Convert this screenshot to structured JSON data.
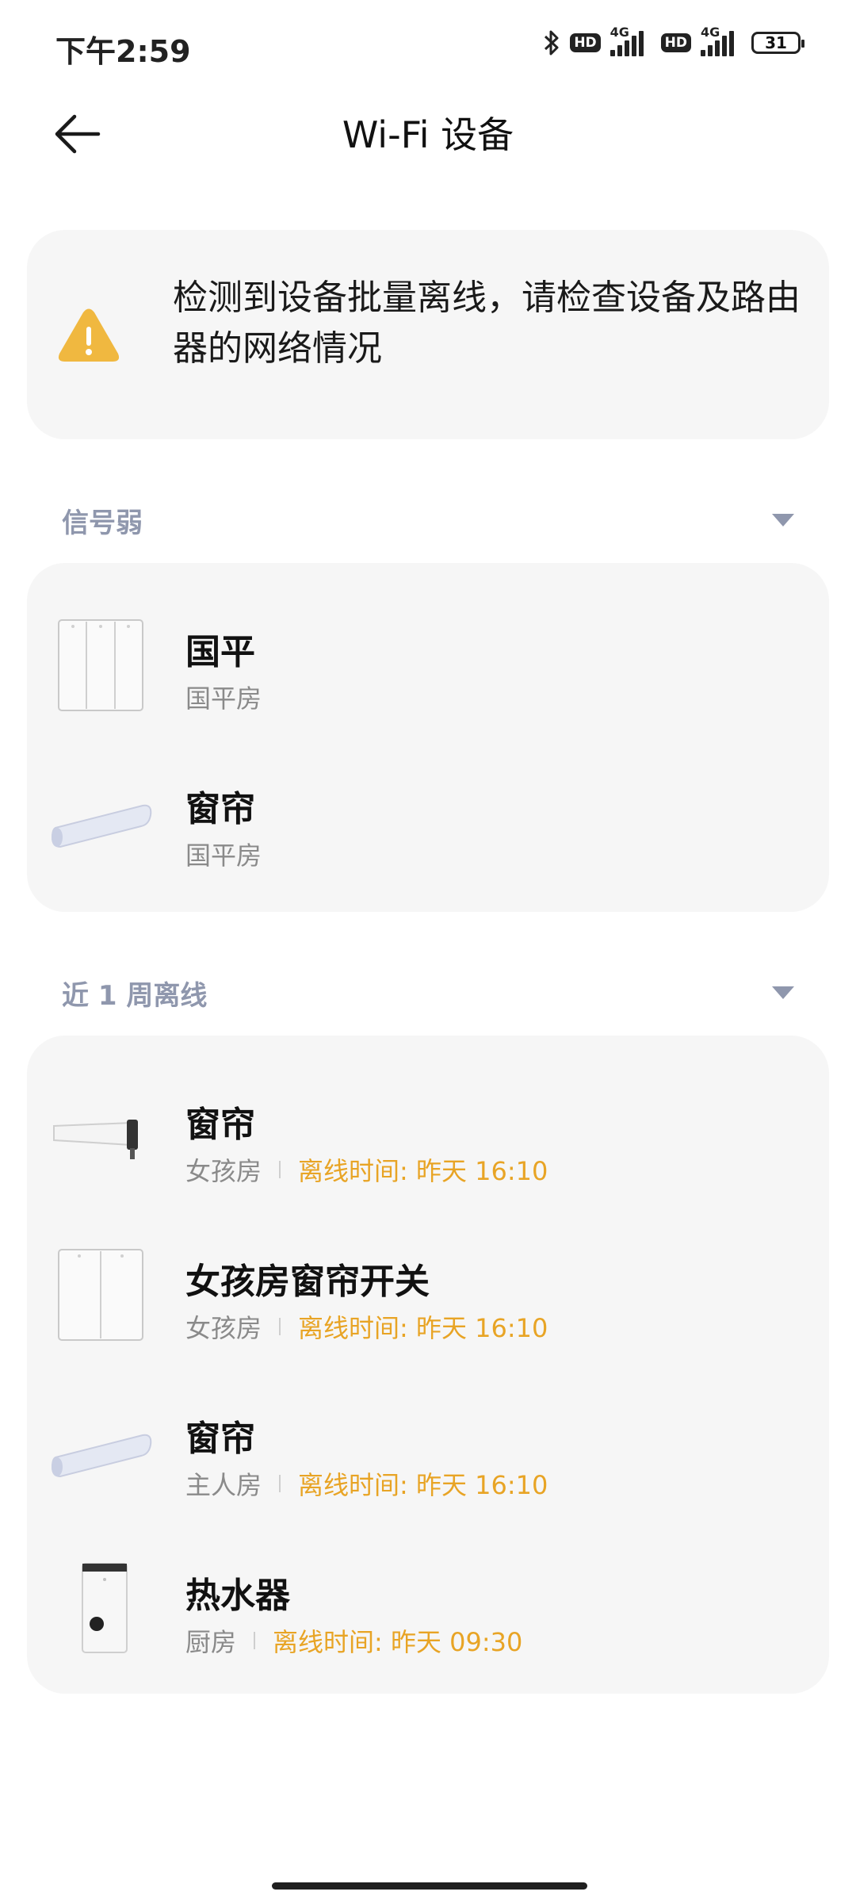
{
  "status_bar": {
    "time": "下午2:59",
    "hd1": "HD",
    "net1": "4G",
    "hd2": "HD",
    "net2": "4G",
    "battery": "31"
  },
  "header": {
    "title": "Wi-Fi 设备"
  },
  "alert": {
    "text": "检测到设备批量离线，请检查设备及路由器的网络情况"
  },
  "sections": [
    {
      "title": "信号弱",
      "devices": [
        {
          "name": "国平",
          "room": "国平房",
          "icon": "triple-switch-icon"
        },
        {
          "name": "窗帘",
          "room": "国平房",
          "icon": "curtain-motor-icon"
        }
      ]
    },
    {
      "title": "近 1 周离线",
      "devices": [
        {
          "name": "窗帘",
          "room": "女孩房",
          "offline": "离线时间: 昨天 16:10",
          "icon": "curtain-rail-icon"
        },
        {
          "name": "女孩房窗帘开关",
          "room": "女孩房",
          "offline": "离线时间: 昨天 16:10",
          "icon": "double-switch-icon"
        },
        {
          "name": "窗帘",
          "room": "主人房",
          "offline": "离线时间: 昨天 16:10",
          "icon": "curtain-motor-icon"
        },
        {
          "name": "热水器",
          "room": "厨房",
          "offline": "离线时间: 昨天 09:30",
          "icon": "water-heater-icon"
        }
      ]
    }
  ],
  "colors": {
    "accent_warning": "#f0b840",
    "offline_text": "#e8a425",
    "section_title": "#8f97ad",
    "card_bg": "#f6f6f6"
  }
}
